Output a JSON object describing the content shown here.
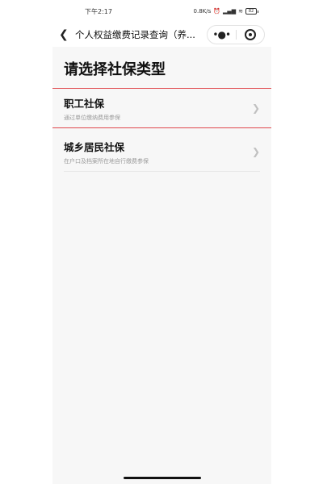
{
  "status_bar": {
    "time": "下午2:17",
    "network_speed": "0.8K/s",
    "battery": "82"
  },
  "nav": {
    "title": "个人权益缴费记录查询（养...",
    "more_icon": "more-dots-icon",
    "close_icon": "target-close-icon"
  },
  "page": {
    "title": "请选择社保类型",
    "items": [
      {
        "title": "职工社保",
        "subtitle": "通过单位缴纳费用参保",
        "selected": true
      },
      {
        "title": "城乡居民社保",
        "subtitle": "在户口及档案所在地自行缴费参保",
        "selected": false
      }
    ]
  },
  "colors": {
    "selection_outline": "#e0474c",
    "background": "#f7f7f7"
  }
}
